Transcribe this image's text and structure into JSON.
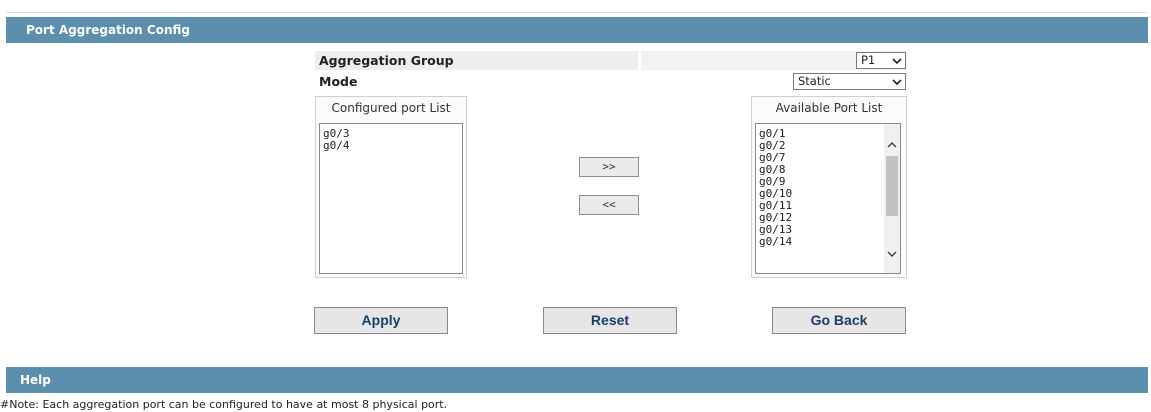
{
  "config_section": {
    "title": "Port Aggregation Config"
  },
  "aggregation_group": {
    "label": "Aggregation Group",
    "value": "P1"
  },
  "mode": {
    "label": "Mode",
    "value": "Static"
  },
  "configured_list": {
    "header": "Configured port List",
    "items": [
      "g0/3",
      "g0/4"
    ]
  },
  "available_list": {
    "header": "Available Port List",
    "items": [
      "g0/1",
      "g0/2",
      "g0/7",
      "g0/8",
      "g0/9",
      "g0/10",
      "g0/11",
      "g0/12",
      "g0/13",
      "g0/14"
    ]
  },
  "move_buttons": {
    "add": ">>",
    "remove": "<<"
  },
  "actions": {
    "apply": "Apply",
    "reset": "Reset",
    "go_back": "Go Back"
  },
  "help_section": {
    "title": "Help",
    "note": "#Note: Each aggregation port can be configured to have at most 8 physical port."
  },
  "icons": {
    "dropdown": "chevron-down-icon",
    "scroll_up": "chevron-up-icon",
    "scroll_down": "chevron-down-icon"
  },
  "colors": {
    "section_bar": "#5b8fad",
    "button_text": "#1b3d6b"
  }
}
